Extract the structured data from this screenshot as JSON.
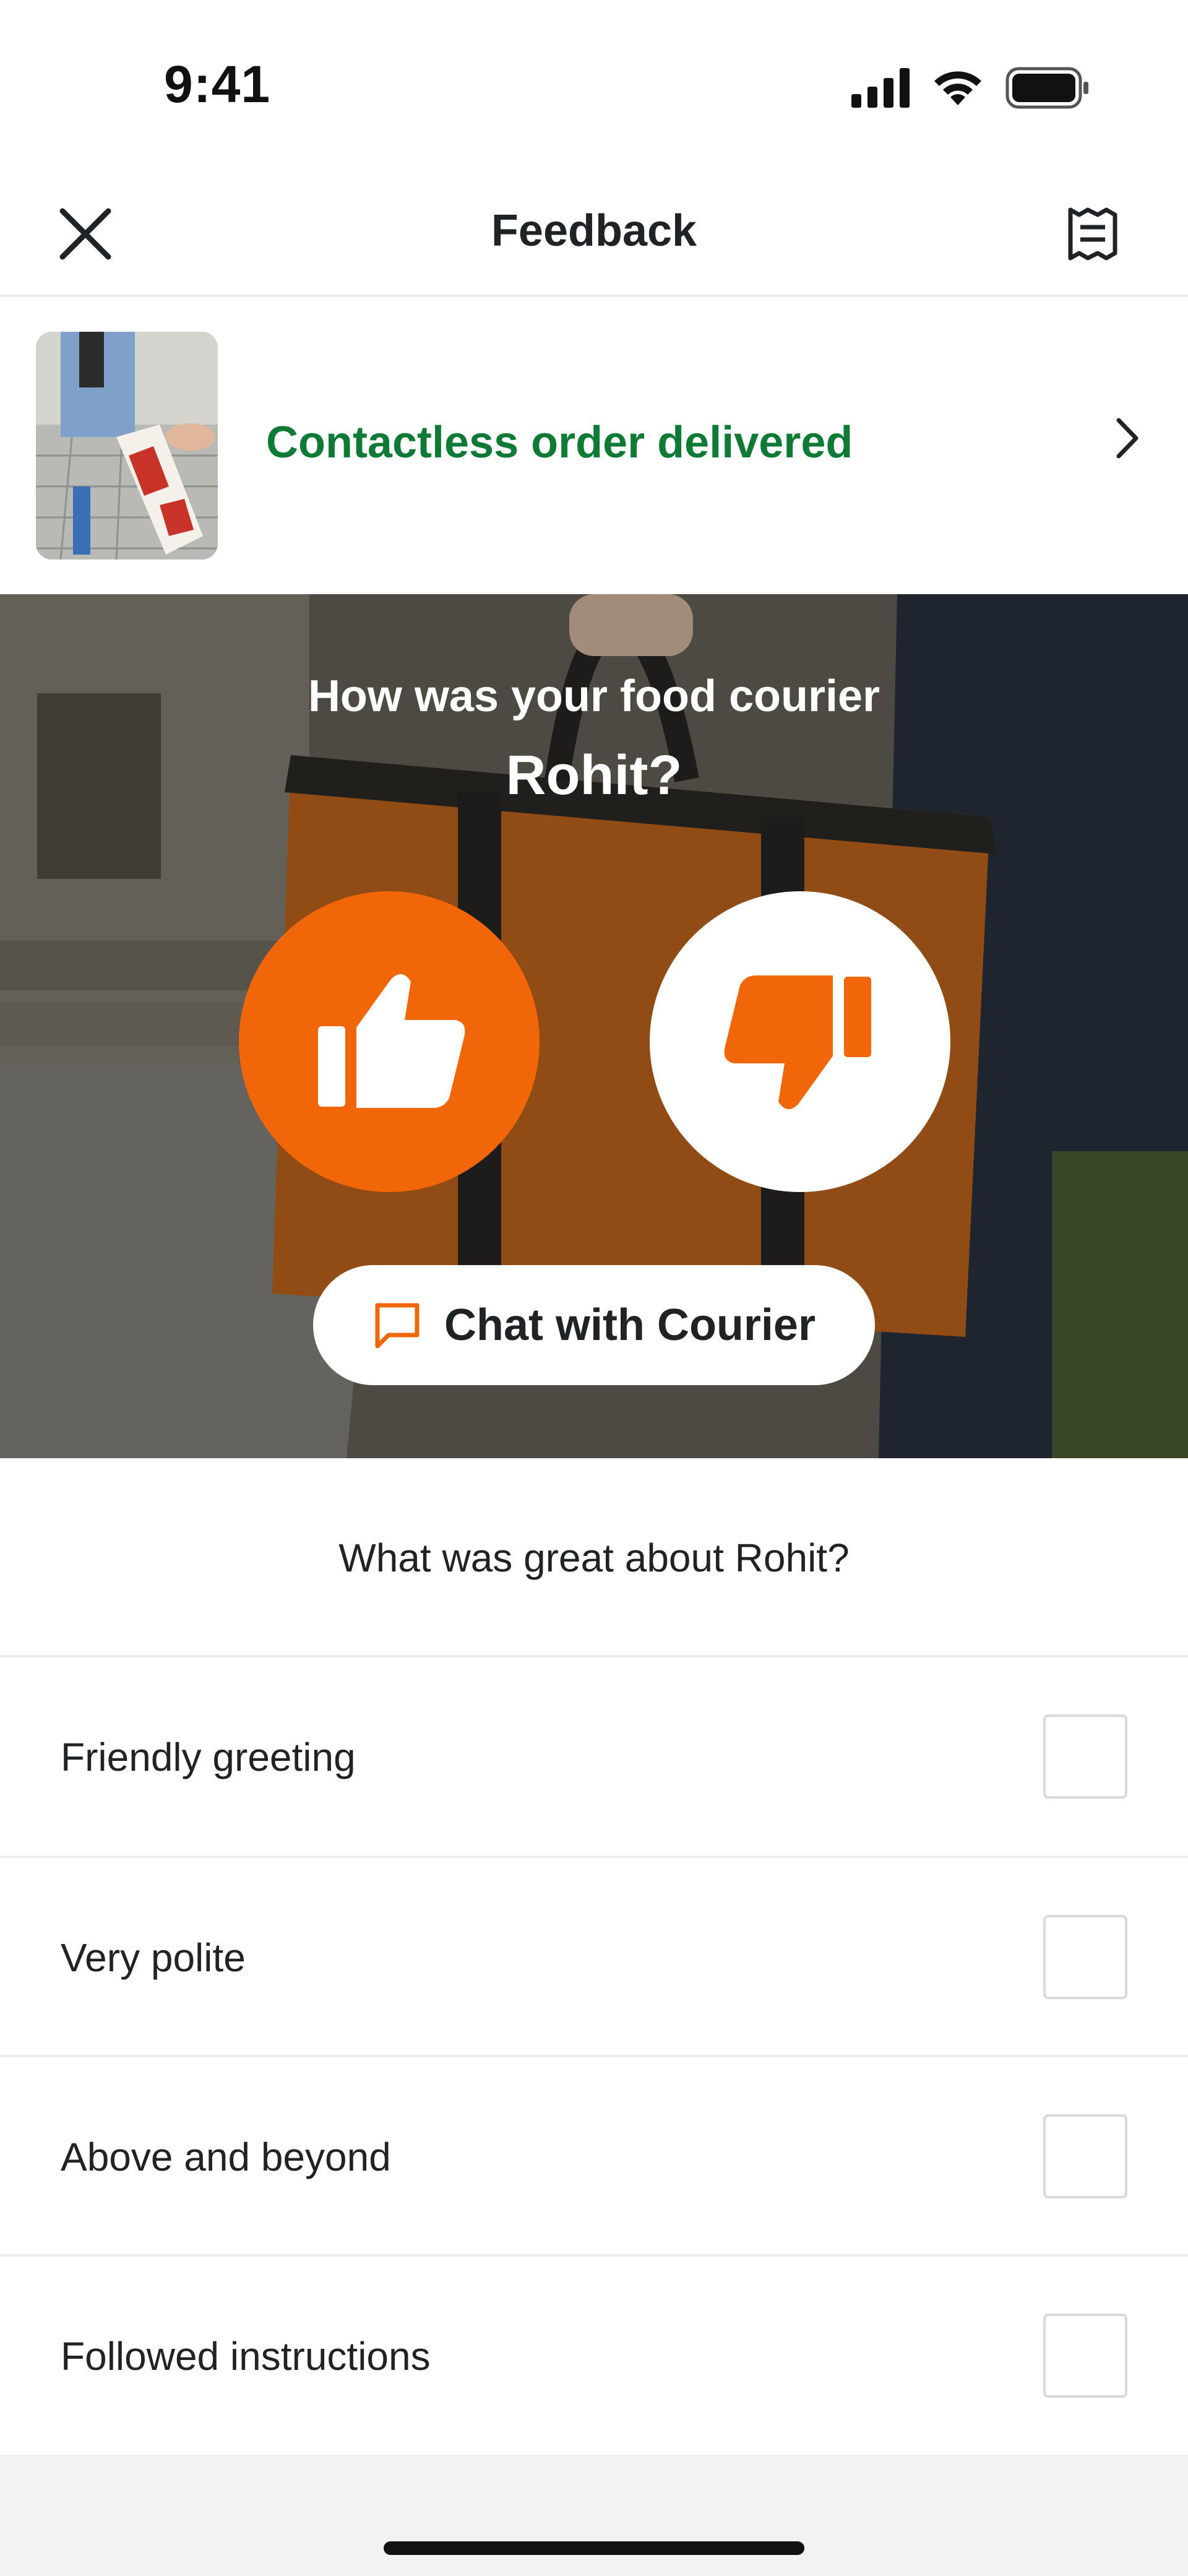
{
  "status_bar": {
    "time": "9:41",
    "icons": [
      "signal-icon",
      "wifi-icon",
      "battery-icon"
    ]
  },
  "header": {
    "title": "Feedback",
    "close_icon": "close-icon",
    "receipt_icon": "receipt-icon"
  },
  "order": {
    "status": "Contactless order delivered",
    "chevron_icon": "chevron-right-icon"
  },
  "hero": {
    "question": "How was your food courier",
    "courier_name": "Rohit?",
    "thumbs_up_icon": "thumbs-up-icon",
    "thumbs_down_icon": "thumbs-down-icon",
    "chat_label": "Chat with Courier",
    "chat_icon": "chat-bubble-icon"
  },
  "feedback": {
    "question": "What was great about Rohit?",
    "options": [
      {
        "label": "Friendly greeting",
        "checked": false
      },
      {
        "label": "Very polite",
        "checked": false
      },
      {
        "label": "Above and beyond",
        "checked": false
      },
      {
        "label": "Followed instructions",
        "checked": false
      }
    ]
  },
  "colors": {
    "accent_orange": "#f2660a",
    "status_green": "#0f7a35",
    "text_dark": "#1f2326",
    "divider": "#ececec"
  }
}
